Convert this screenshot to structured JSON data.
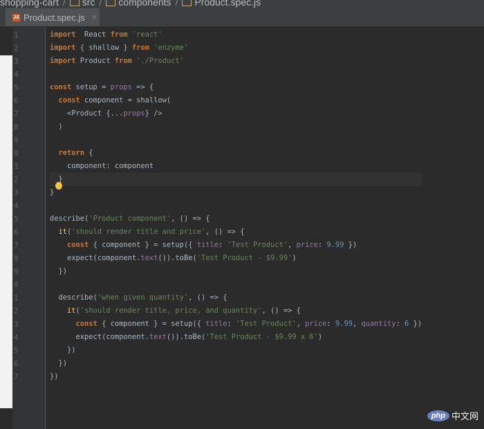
{
  "breadcrumbs": [
    "shopping-cart",
    "src",
    "components",
    "Product.spec.js"
  ],
  "tab": {
    "label": "Product.spec.js",
    "icon": "JS"
  },
  "line_numbers": [
    "1",
    "2",
    "3",
    "4",
    "5",
    "6",
    "7",
    "8",
    "9",
    "0",
    "1",
    "2",
    "3",
    "4",
    "5",
    "6",
    "7",
    "8",
    "9",
    "0",
    "1",
    "2",
    "3",
    "4",
    "5",
    "6",
    "7"
  ],
  "code": [
    [
      [
        "kw",
        "import"
      ],
      [
        "",
        "  React "
      ],
      [
        "kw",
        "from"
      ],
      [
        "str",
        " 'react'"
      ]
    ],
    [
      [
        "kw",
        "import"
      ],
      [
        "",
        " { shallow } "
      ],
      [
        "kw",
        "from"
      ],
      [
        "str",
        " 'enzyme'"
      ]
    ],
    [
      [
        "kw",
        "import"
      ],
      [
        "",
        " Product "
      ],
      [
        "kw",
        "from"
      ],
      [
        "str",
        " './Product'"
      ]
    ],
    [],
    [
      [
        "kw",
        "const"
      ],
      [
        "",
        " setup = "
      ],
      [
        "pur",
        "props"
      ],
      [
        "",
        " => {"
      ]
    ],
    [
      [
        "",
        "  "
      ],
      [
        "kw",
        "const"
      ],
      [
        "",
        " component = shallow("
      ]
    ],
    [
      [
        "",
        "    <Product {..."
      ],
      [
        "pur",
        "props"
      ],
      [
        "",
        "} />"
      ]
    ],
    [
      [
        "",
        "  )"
      ]
    ],
    [],
    [
      [
        "",
        "  "
      ],
      [
        "kw",
        "return"
      ],
      [
        "",
        " {"
      ]
    ],
    [
      [
        "",
        "    component: component"
      ]
    ],
    [
      [
        "",
        "  }"
      ]
    ],
    [
      [
        "",
        "}"
      ]
    ],
    [],
    [
      [
        "",
        "describe("
      ],
      [
        "str",
        "'Product component'"
      ],
      [
        "",
        ", () => {"
      ]
    ],
    [
      [
        "",
        "  "
      ],
      [
        "fn",
        "it"
      ],
      [
        "",
        "("
      ],
      [
        "str",
        "'should render title and price'"
      ],
      [
        "",
        ", () => {"
      ]
    ],
    [
      [
        "",
        "    "
      ],
      [
        "kw",
        "const"
      ],
      [
        "",
        " { component } = setup({ "
      ],
      [
        "pur",
        "title"
      ],
      [
        "",
        ": "
      ],
      [
        "str",
        "'Test Product'"
      ],
      [
        "",
        ", "
      ],
      [
        "pur",
        "price"
      ],
      [
        "",
        ": "
      ],
      [
        "num",
        "9.99"
      ],
      [
        "",
        " })"
      ]
    ],
    [
      [
        "",
        "    expect(component."
      ],
      [
        "pur",
        "text"
      ],
      [
        "",
        "()).toBe("
      ],
      [
        "str",
        "'Test Product - $9.99'"
      ],
      [
        "",
        ")"
      ]
    ],
    [
      [
        "",
        "  })"
      ]
    ],
    [],
    [
      [
        "",
        "  describe("
      ],
      [
        "str",
        "'when given quantity'"
      ],
      [
        "",
        ", () => {"
      ]
    ],
    [
      [
        "",
        "    "
      ],
      [
        "fn",
        "it"
      ],
      [
        "",
        "("
      ],
      [
        "str",
        "'should render title, price, and quantity'"
      ],
      [
        "",
        ", () => {"
      ]
    ],
    [
      [
        "",
        "      "
      ],
      [
        "kw",
        "const"
      ],
      [
        "",
        " { component } = setup({ "
      ],
      [
        "pur",
        "title"
      ],
      [
        "",
        ": "
      ],
      [
        "str",
        "'Test Product'"
      ],
      [
        "",
        ", "
      ],
      [
        "pur",
        "price"
      ],
      [
        "",
        ": "
      ],
      [
        "num",
        "9.99"
      ],
      [
        "",
        ", "
      ],
      [
        "pur",
        "quantity"
      ],
      [
        "",
        ": "
      ],
      [
        "num",
        "6"
      ],
      [
        "",
        " })"
      ]
    ],
    [
      [
        "",
        "      expect(component."
      ],
      [
        "pur",
        "text"
      ],
      [
        "",
        "()).toBe("
      ],
      [
        "str",
        "'Test Product - $9.99 x 6'"
      ],
      [
        "",
        ")"
      ]
    ],
    [
      [
        "",
        "    })"
      ]
    ],
    [
      [
        "",
        "  })"
      ]
    ],
    [
      [
        "",
        "})"
      ]
    ]
  ],
  "watermark": {
    "logo": "php",
    "text": "中文网"
  }
}
